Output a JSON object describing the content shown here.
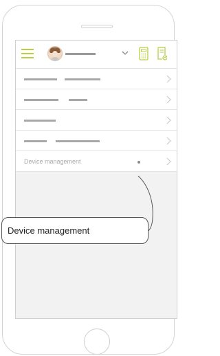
{
  "colors": {
    "accent": "#b7cf43",
    "menu_placeholder": "#a8a8a8",
    "screen_background": "#f2f2f2",
    "callout_border": "#555555"
  },
  "header": {
    "menu_icon": "hamburger-icon",
    "avatar_icon": "user-avatar",
    "dropdown_icon": "chevron-down-icon",
    "action_icons": [
      "calculator-icon",
      "report-icon"
    ]
  },
  "menu": {
    "rows": [
      {
        "type": "placeholder"
      },
      {
        "type": "placeholder"
      },
      {
        "type": "placeholder"
      },
      {
        "type": "placeholder"
      },
      {
        "type": "text",
        "label": "Device management"
      }
    ],
    "chevron_icon": "chevron-right-icon"
  },
  "callout": {
    "label": "Device management"
  }
}
